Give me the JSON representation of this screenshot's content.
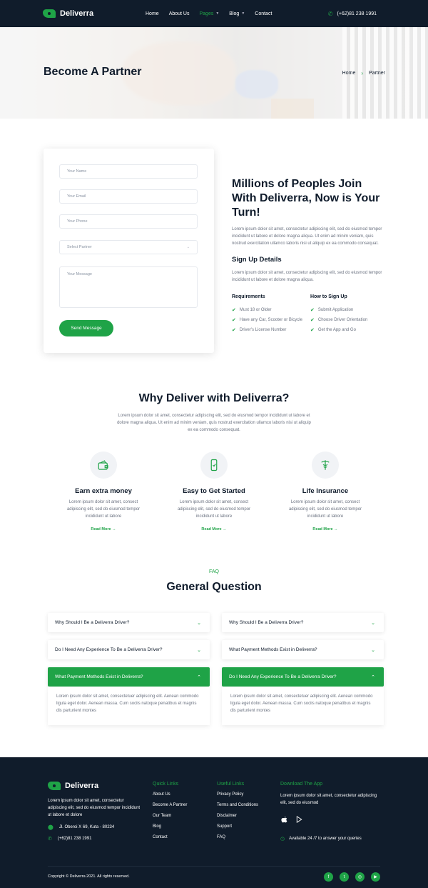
{
  "header": {
    "brand": "Deliverra",
    "nav": [
      {
        "label": "Home",
        "active": false,
        "dropdown": false
      },
      {
        "label": "About Us",
        "active": false,
        "dropdown": false
      },
      {
        "label": "Pages",
        "active": true,
        "dropdown": true
      },
      {
        "label": "Blog",
        "active": false,
        "dropdown": true
      },
      {
        "label": "Contact",
        "active": false,
        "dropdown": false
      }
    ],
    "phone": "(+62)81 238 1991"
  },
  "hero": {
    "title": "Become A Partner",
    "breadcrumb": [
      "Home",
      "Partner"
    ]
  },
  "form": {
    "name_placeholder": "Your Name",
    "email_placeholder": "Your Email",
    "phone_placeholder": "Your Phone",
    "partner_select": "Select Partner",
    "message_placeholder": "Your Message",
    "submit_label": "Send Message"
  },
  "join": {
    "title": "Millions of Peoples Join With Deliverra, Now is Your Turn!",
    "desc": "Lorem ipsum dolor sit amet, consectetur adipiscing elit, sed do eiusmod tempor incididunt ut labore et dolore magna aliqua. Ut enim ad minim veniam, quis nostrud exercitation ullamco laboris nisi ut aliquip ex ea commodo consequat.",
    "signup_title": "Sign Up Details",
    "signup_desc": "Lorem ipsum dolor sit amet, consectetur adipiscing elit, sed do eiusmod tempor incididunt ut labore et dolore magna aliqua.",
    "requirements_title": "Requirements",
    "requirements": [
      "Must 18 or Older",
      "Have any Car, Scooter or Bicycle",
      "Driver's License Number"
    ],
    "howto_title": "How to Sign Up",
    "howto": [
      "Submit Application",
      "Choose Driver Orientation",
      "Get the App and Go"
    ]
  },
  "why": {
    "title": "Why Deliver with Deliverra?",
    "desc": "Lorem ipsum dolor sit amet, consectetur adipiscing elit, sed do eiusmod tempor incididunt ut labore et dolore magna aliqua. Ut enim ad minim veniam, quis nostrud exercitation ullamco laboris nisi ut aliquip ex ea commodo consequat.",
    "features": [
      {
        "icon": "wallet-icon",
        "title": "Earn extra money",
        "desc": "Lorem ipsum dolor sit amet, consect adipiscing elit, sed do eiusmod tempor incididunt ut labore",
        "more": "Read More"
      },
      {
        "icon": "smartphone-icon",
        "title": "Easy to Get Started",
        "desc": "Lorem ipsum dolor sit amet, consect adipiscing elit, sed do eiusmod tempor incididunt ut labore",
        "more": "Read More"
      },
      {
        "icon": "medical-icon",
        "title": "Life Insurance",
        "desc": "Lorem ipsum dolor sit amet, consect adipiscing elit, sed do eiusmod tempor incididunt ut labore",
        "more": "Read More"
      }
    ]
  },
  "faq": {
    "tag": "FAQ",
    "title": "General Question",
    "left": [
      {
        "q": "Why Should I Be a Deliverra Driver?",
        "open": false
      },
      {
        "q": "Do I Need Any Experience To Be a Deliverra Driver?",
        "open": false
      },
      {
        "q": "What Payment Methods Exist in Deliverra?",
        "open": true
      }
    ],
    "right": [
      {
        "q": "Why Should I Be a Deliverra Driver?",
        "open": false
      },
      {
        "q": "What Payment Methods Exist in Deliverra?",
        "open": false
      },
      {
        "q": "Do I Need Any Experience To Be a Deliverra Driver?",
        "open": true
      }
    ],
    "answer": "Lorem ipsum dolor sit amet, consectetuer adipiscing elit. Aenean commodo ligula eget dolor. Aenean massa. Cum sociis natoque penatibus et magnis dis parturient montes"
  },
  "footer": {
    "brand": "Deliverra",
    "about": "Lorem ipsum dolor sit amet, consectetur adipiscing elit, sed do eiusmod tempor incididunt ut labore et dolore",
    "address": "Jl. Oberoi X 69, Kuta - 80234",
    "phone": "(+62)81 238 1991",
    "quick_links_title": "Quick Links",
    "quick_links": [
      "About Us",
      "Become A Partner",
      "Our Team",
      "Blog",
      "Contact"
    ],
    "useful_links_title": "Useful Links",
    "useful_links": [
      "Privacy Policy",
      "Terms and Conditions",
      "Disclaimer",
      "Support",
      "FAQ"
    ],
    "app_title": "Download The App",
    "app_desc": "Lorem ipsum dolor sit amet, consectetur adipiscing elit, sed do eiusmod",
    "availability": "Available 24 /7 to answer your queries",
    "copyright": "Copyright © Deliverra 2021. All rights reserved.",
    "socials": [
      "facebook-icon",
      "twitter-icon",
      "instagram-icon",
      "youtube-icon"
    ]
  },
  "colors": {
    "accent": "#1fa347",
    "dark": "#101c2b"
  }
}
